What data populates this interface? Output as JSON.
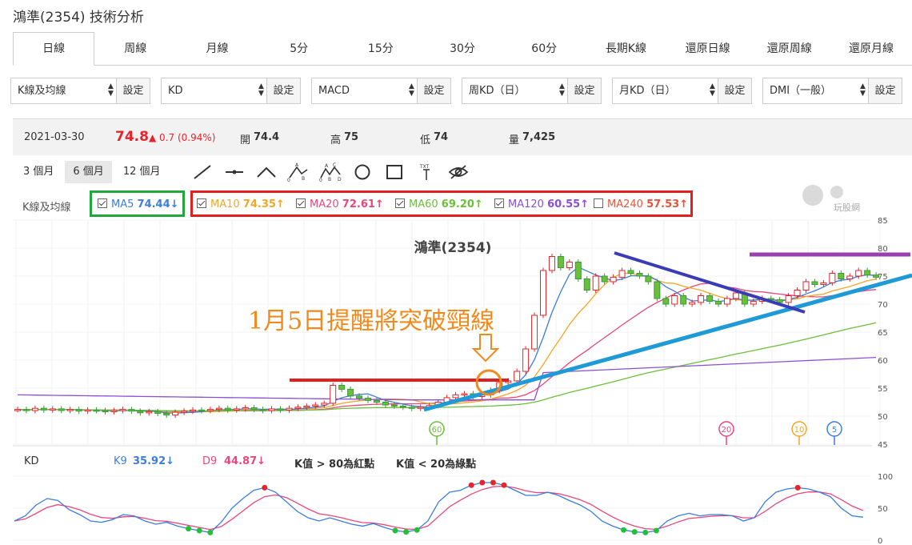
{
  "title": "鴻準(2354) 技術分析",
  "tabs": [
    "日線",
    "周線",
    "月線",
    "5分",
    "15分",
    "30分",
    "60分",
    "長期K線",
    "還原日線",
    "還原周線",
    "還原月線"
  ],
  "active_tab": "日線",
  "selects": [
    {
      "value": "K線及均線",
      "button": "設定"
    },
    {
      "value": "KD",
      "button": "設定"
    },
    {
      "value": "MACD",
      "button": "設定"
    },
    {
      "value": "周KD（日）",
      "button": "設定"
    },
    {
      "value": "月KD（日）",
      "button": "設定"
    },
    {
      "value": "DMI（一般）",
      "button": "設定"
    }
  ],
  "info": {
    "date": "2021-03-30",
    "price": "74.8",
    "change": "▲ 0.7 (0.94%)",
    "open_label": "開",
    "open": "74.4",
    "high_label": "高",
    "high": "75",
    "low_label": "低",
    "low": "74",
    "vol_label": "量",
    "vol": "7,425"
  },
  "ranges": [
    "3 個月",
    "6 個月",
    "12 個月"
  ],
  "active_range": "6 個月",
  "tools": [
    "line-tool-icon",
    "segment-tool-icon",
    "angle-tool-icon",
    "abc-pattern-icon",
    "abcd-pattern-icon",
    "circle-tool-icon",
    "rectangle-tool-icon",
    "text-tool-icon",
    "hide-drawings-icon"
  ],
  "ma_label": "K線及均線",
  "ma": [
    {
      "name": "MA5",
      "value": "74.44↓",
      "checked": true,
      "color": "#3b7ddd"
    },
    {
      "name": "MA10",
      "value": "74.35↑",
      "checked": true,
      "color": "#f5a623"
    },
    {
      "name": "MA20",
      "value": "72.61↑",
      "checked": true,
      "color": "#e8477a"
    },
    {
      "name": "MA60",
      "value": "69.20↑",
      "checked": true,
      "color": "#6bbf3a"
    },
    {
      "name": "MA120",
      "value": "60.55↑",
      "checked": true,
      "color": "#8a4fd6"
    },
    {
      "name": "MA240",
      "value": "57.53↑",
      "checked": false,
      "color": "#e8543b"
    }
  ],
  "logo_text": "玩股網",
  "chart_data": [
    {
      "type": "candlestick",
      "title": "鴻準(2354)",
      "annotation": "1月5日提醒將突破頸線",
      "ylim": [
        45,
        85
      ],
      "yticks": [
        85,
        80,
        75,
        70,
        65,
        60,
        55,
        50,
        45
      ],
      "markers": [
        "60",
        "20",
        "10",
        "5"
      ],
      "closes": [
        51.2,
        51.0,
        51.4,
        51.1,
        51.3,
        51.0,
        51.2,
        50.9,
        51.1,
        51.0,
        50.8,
        51.0,
        51.2,
        50.9,
        50.6,
        50.8,
        50.5,
        50.2,
        50.7,
        50.9,
        51.1,
        51.0,
        51.2,
        51.4,
        51.1,
        51.3,
        51.5,
        51.2,
        51.0,
        51.3,
        51.1,
        51.4,
        51.6,
        51.8,
        52.0,
        52.3,
        55.5,
        54.8,
        53.6,
        53.2,
        52.8,
        52.5,
        52.0,
        51.8,
        51.6,
        51.4,
        51.6,
        51.9,
        52.5,
        53.3,
        53.8,
        54.0,
        53.5,
        53.8,
        54.6,
        56.0,
        56.3,
        58.0,
        62.0,
        68.0,
        76.0,
        78.5,
        76.5,
        77.5,
        74.5,
        72.5,
        75.0,
        74.0,
        74.8,
        76.0,
        75.5,
        75.0,
        74.0,
        71.0,
        70.0,
        71.5,
        70.0,
        70.3,
        71.5,
        70.5,
        70.0,
        71.0,
        72.0,
        70.0,
        70.5,
        71.0,
        70.8,
        70.3,
        71.5,
        72.5,
        74.0,
        73.5,
        73.8,
        75.5,
        74.5,
        75.0,
        76.0,
        75.2,
        74.8
      ],
      "ma5_end": 74.44,
      "ma10_end": 74.35,
      "ma20_end": 72.61,
      "ma60_end": 69.2,
      "ma120_end": 60.55
    },
    {
      "type": "line",
      "title": "KD",
      "series": [
        {
          "name": "K9",
          "value_label": "35.92↓"
        },
        {
          "name": "D9",
          "value_label": "44.87↓"
        }
      ],
      "ylim": [
        0,
        100
      ],
      "yticks": [
        100,
        50,
        0
      ]
    }
  ],
  "kd": {
    "label": "KD",
    "k_name": "K9",
    "k_value": "35.92↓",
    "d_name": "D9",
    "d_value": "44.87↓",
    "note1": "K值 > 80為紅點",
    "note2": "K值 < 20為綠點"
  }
}
